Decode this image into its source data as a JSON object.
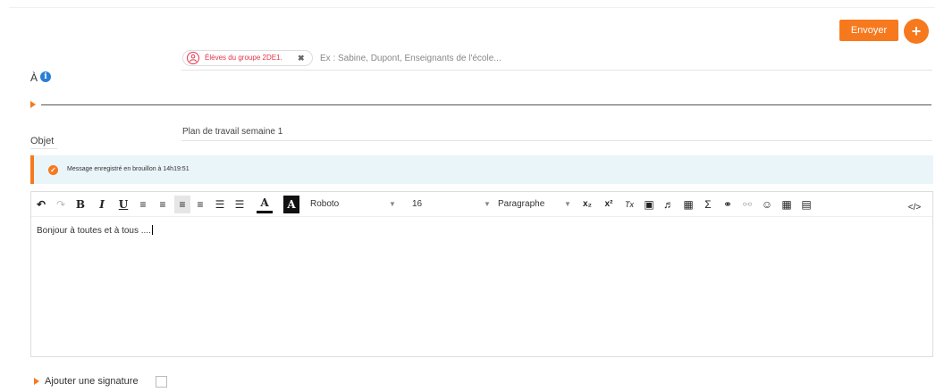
{
  "header": {
    "send_label": "Envoyer",
    "add_label": "+"
  },
  "recipients": {
    "label": "À",
    "info_icon": "i",
    "chip": {
      "icon": "user-icon",
      "label": "Élèves du groupe 2DE1.",
      "remove": "✖"
    },
    "placeholder": "Ex : Sabine, Dupont, Enseignants de l'école..."
  },
  "subject": {
    "label": "Objet",
    "value": "Plan de travail semaine 1"
  },
  "draft_notice": {
    "icon": "✓",
    "text": "Message enregistré en brouillon à 14h19:51"
  },
  "toolbar": {
    "undo": "↶",
    "redo": "↷",
    "bold": "B",
    "italic": "I",
    "underline": "U",
    "align_justify": "≡",
    "align_center": "≡",
    "align_left": "≡",
    "align_right": "≡",
    "bullet_list": "☰",
    "numbered_list": "☰",
    "text_color": "A",
    "bg_color": "A",
    "font_family": "Roboto",
    "font_size": "16",
    "block_format": "Paragraphe",
    "subscript": "x₂",
    "superscript": "x²",
    "clear_format": "Tx",
    "image": "▣",
    "audio": "♬",
    "video": "▦",
    "formula": "Σ",
    "link": "⚭",
    "unlink": "⚯",
    "emoji": "☺",
    "table": "▦",
    "attachment": "▤",
    "code_view": "</>",
    "caret": "▼"
  },
  "editor": {
    "body_text": "Bonjour à toutes et à tous ...."
  },
  "signature": {
    "label": "Ajouter une signature"
  },
  "colors": {
    "accent": "#f7791e",
    "info": "#2a7fd4",
    "chip_red": "#e4334a",
    "banner_bg": "#eaf5f9"
  }
}
